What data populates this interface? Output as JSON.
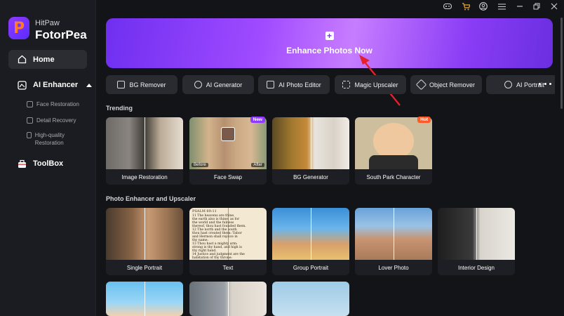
{
  "app": {
    "brand_top": "HitPaw",
    "brand_name": "FotorPea",
    "logo_letter": "P"
  },
  "sidebar": {
    "home": "Home",
    "ai_enhancer": "AI Enhancer",
    "sub": [
      "Face Restoration",
      "Detail Recovery",
      "High-quality Restoration"
    ],
    "toolbox": "ToolBox"
  },
  "topbar": {
    "icons": [
      "gamepad-icon",
      "cart-icon",
      "user-icon",
      "menu-icon",
      "minimize-icon",
      "restore-icon",
      "close-icon"
    ]
  },
  "banner": {
    "label": "Enhance Photos Now",
    "plus": "+"
  },
  "tools": [
    "BG Remover",
    "AI Generator",
    "AI Photo Editor",
    "Magic Upscaler",
    "Object Remover",
    "AI Portrait"
  ],
  "trending": {
    "title": "Trending",
    "cards": [
      {
        "label": "Image Restoration"
      },
      {
        "label": "Face Swap",
        "badge": "New",
        "before": "Before",
        "after": "After"
      },
      {
        "label": "BG Generator"
      },
      {
        "label": "South Park Character",
        "badge": "Hot"
      }
    ]
  },
  "enhancer": {
    "title": "Photo Enhancer and Upscaler",
    "cards": [
      "Single Portrait",
      "Text",
      "Group Portrait",
      "Lover Photo",
      "Interior Design"
    ],
    "text_sample_header": "PSALM 89:11",
    "text_sample_lines": [
      "11 The heavens are thine,",
      "the earth also is thine: as for",
      "the world and the fulness",
      "thereof, thou hast founded them.",
      "12 The north and the south",
      "thou hast created them: Tabor",
      "and Hermon shall rejoice in",
      "thy name.",
      "13 Thou hast a mighty arm:",
      "strong is thy hand, and high is",
      "thy right hand.",
      "14 Justice and judgment are the",
      "habitation of thy throne:"
    ]
  },
  "colors": {
    "accent": "#8f3bff",
    "badge_new": "#8f3bff",
    "badge_hot": "#ff5a2a",
    "arrow": "#e5202a"
  }
}
